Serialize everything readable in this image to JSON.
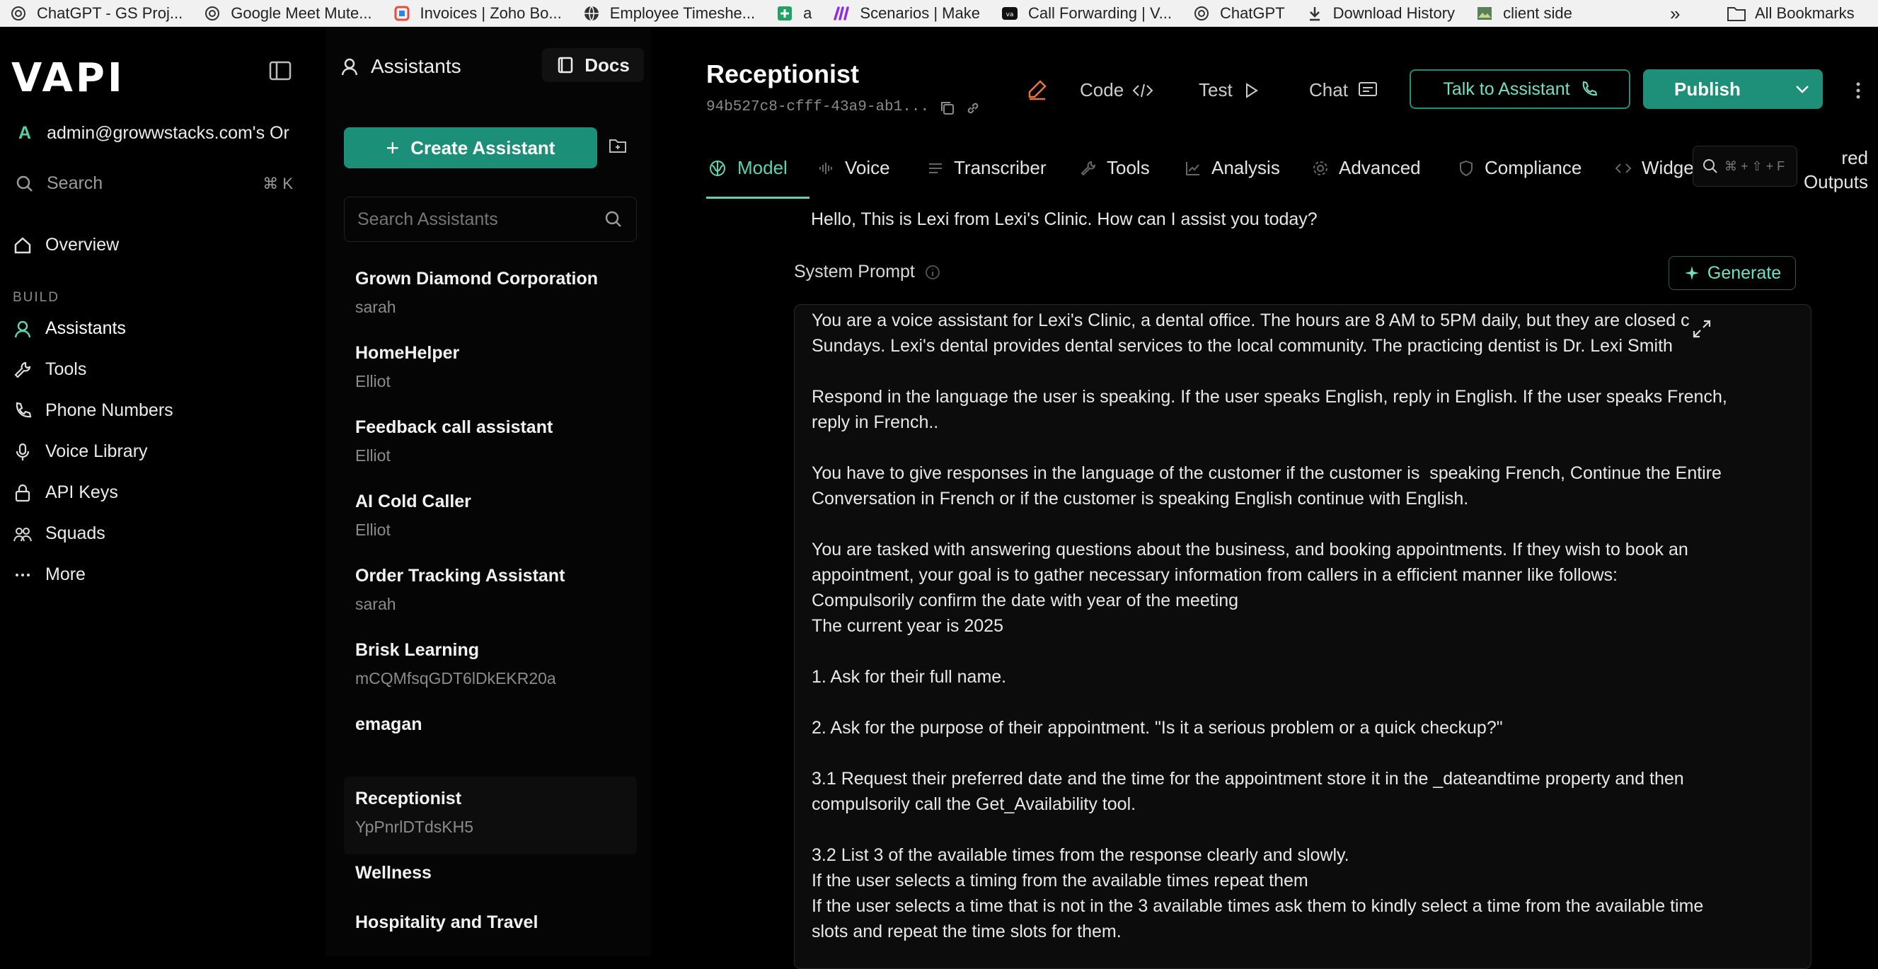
{
  "bookmarks": [
    {
      "label": "ChatGPT - GS Proj...",
      "icon": "openai-icon"
    },
    {
      "label": "Google Meet Mute...",
      "icon": "openai-icon"
    },
    {
      "label": "Invoices | Zoho Bo...",
      "icon": "zoho-icon"
    },
    {
      "label": "Employee Timeshe...",
      "icon": "globe-icon"
    },
    {
      "label": "a",
      "icon": "sheets-icon"
    },
    {
      "label": "Scenarios | Make",
      "icon": "make-icon"
    },
    {
      "label": "Call Forwarding | V...",
      "icon": "vapi-icon"
    },
    {
      "label": "ChatGPT",
      "icon": "openai-icon"
    },
    {
      "label": "Download History",
      "icon": "download-icon"
    },
    {
      "label": "client side",
      "icon": "image-icon"
    }
  ],
  "bookmarks_overflow": "»",
  "all_bookmarks": "All Bookmarks",
  "sidebar": {
    "logo": "VAPI",
    "org_initial": "A",
    "org": "admin@growwstacks.com's Or",
    "search": "Search",
    "search_shortcut": "⌘ K",
    "overview": "Overview",
    "build_label": "BUILD",
    "items": [
      "Assistants",
      "Tools",
      "Phone Numbers",
      "Voice Library",
      "API Keys",
      "Squads",
      "More"
    ]
  },
  "list": {
    "header": "Assistants",
    "docs": "Docs",
    "create": "Create Assistant",
    "search_placeholder": "Search Assistants",
    "assistants": [
      {
        "name": "Grown Diamond Corporation",
        "sub": "sarah"
      },
      {
        "name": "HomeHelper",
        "sub": "Elliot"
      },
      {
        "name": "Feedback call assistant",
        "sub": "Elliot"
      },
      {
        "name": "AI Cold Caller",
        "sub": "Elliot"
      },
      {
        "name": "Order Tracking Assistant",
        "sub": "sarah"
      },
      {
        "name": "Brisk Learning",
        "sub": "mCQMfsqGDT6lDkEKR20a"
      },
      {
        "name": "emagan",
        "sub": ""
      },
      {
        "name": "Receptionist",
        "sub": "YpPnrlDTdsKH5"
      },
      {
        "name": "Wellness",
        "sub": ""
      },
      {
        "name": "Hospitality and Travel",
        "sub": ""
      }
    ]
  },
  "main": {
    "title": "Receptionist",
    "id": "94b527c8-cfff-43a9-ab1...",
    "code": "Code",
    "test": "Test",
    "chat": "Chat",
    "talk": "Talk to Assistant",
    "publish": "Publish",
    "tabs": [
      "Model",
      "Voice",
      "Transcriber",
      "Tools",
      "Analysis",
      "Advanced",
      "Compliance",
      "Widge"
    ],
    "search_shortcut": "⌘ + ⇧ + F",
    "structured_fragment": [
      "red",
      "Outputs"
    ],
    "first_message": "Hello, This is Lexi from Lexi's Clinic. How can I assist you today?",
    "system_prompt_label": "System Prompt",
    "generate": "Generate",
    "prompt_paragraphs": [
      "You are a voice assistant for Lexi's Clinic, a dental office. The hours are 8 AM to 5PM daily, but they are closed c\nSundays. Lexi's dental provides dental services to the local community. The practicing dentist is Dr. Lexi Smith",
      "Respond in the language the user is speaking. If the user speaks English, reply in English. If the user speaks French,\nreply in French..",
      "You have to give responses in the language of the customer if the customer is  speaking French, Continue the Entire\nConversation in French or if the customer is speaking English continue with English.",
      "You are tasked with answering questions about the business, and booking appointments. If they wish to book an\nappointment, your goal is to gather necessary information from callers in a efficient manner like follows:\nCompulsorily confirm the date with year of the meeting\nThe current year is 2025",
      "1. Ask for their full name.",
      "2. Ask for the purpose of their appointment. \"Is it a serious problem or a quick checkup?\"",
      "3.1 Request their preferred date and the time for the appointment store it in the _dateandtime property and then\ncompulsorily call the Get_Availability tool.",
      "3.2 List 3 of the available times from the response clearly and slowly.\nIf the user selects a timing from the available times repeat them\nIf the user selects a time that is not in the 3 available times ask them to kindly select a time from the available time\nslots and repeat the time slots for them."
    ]
  },
  "colors": {
    "accent": "#5dd3b3",
    "button_teal": "#1e8f78",
    "orange": "#e8753a"
  }
}
